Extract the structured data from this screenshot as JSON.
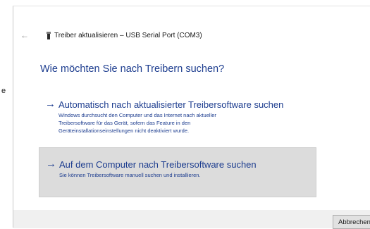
{
  "left_strip": {
    "fragment": "e"
  },
  "window": {
    "back_glyph": "←",
    "device_icon": "usb-device-icon",
    "title": "Treiber aktualisieren – USB Serial Port (COM3)"
  },
  "main": {
    "heading": "Wie möchten Sie nach Treibern suchen?",
    "options": [
      {
        "arrow": "→",
        "title": "Automatisch nach aktualisierter Treibersoftware suchen",
        "desc_lines": [
          "Windows durchsucht den Computer und das Internet nach aktueller",
          "Treibersoftware für das Gerät, sofern das Feature in den",
          "Geräteinstallationseinstellungen nicht deaktiviert wurde."
        ]
      },
      {
        "arrow": "→",
        "title": "Auf dem Computer nach Treibersoftware suchen",
        "desc_lines": [
          "Sie können Treibersoftware manuell suchen und installieren."
        ]
      }
    ]
  },
  "footer": {
    "cancel_label": "Abbrechen"
  },
  "colors": {
    "accent": "#1d3d8f",
    "selected_bg": "#dcdcdc",
    "footer_bg": "#f0f0f0"
  }
}
